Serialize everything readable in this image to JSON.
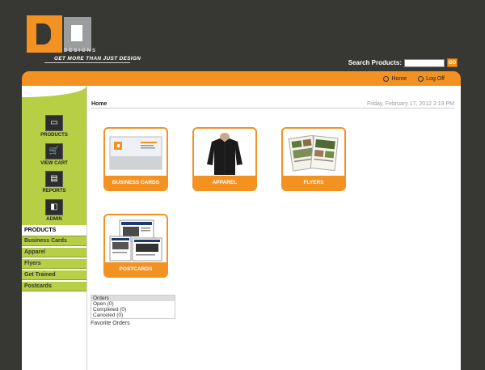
{
  "logo": {
    "designs": "DESIGNS",
    "tagline": "GET MORE THAN JUST DESIGN"
  },
  "search": {
    "label": "Search Products:",
    "go": "GO",
    "value": ""
  },
  "nav": {
    "home": "Home",
    "logoff": "Log Off"
  },
  "sidebar": {
    "buttons": [
      "PRODUCTS",
      "VIEW CART",
      "REPORTS",
      "ADMIN"
    ],
    "products_heading": "PRODUCTS",
    "items": [
      "Business Cards",
      "Apparel",
      "Flyers",
      "Get Trained",
      "Postcards"
    ]
  },
  "main": {
    "breadcrumb": "Home",
    "date": "Friday, February 17, 2012 2:19 PM"
  },
  "products": [
    "BUSINESS CARDS",
    "APPAREL",
    "FLYERS",
    "POSTCARDS"
  ],
  "orders": {
    "title": "Orders",
    "rows": [
      "Open (0)",
      "Completed (0)",
      "Canceled (0)"
    ],
    "favorite": "Favorite Orders"
  },
  "colors": {
    "accent": "#f39121",
    "sidebar": "#b6cf45",
    "background": "#373833"
  }
}
